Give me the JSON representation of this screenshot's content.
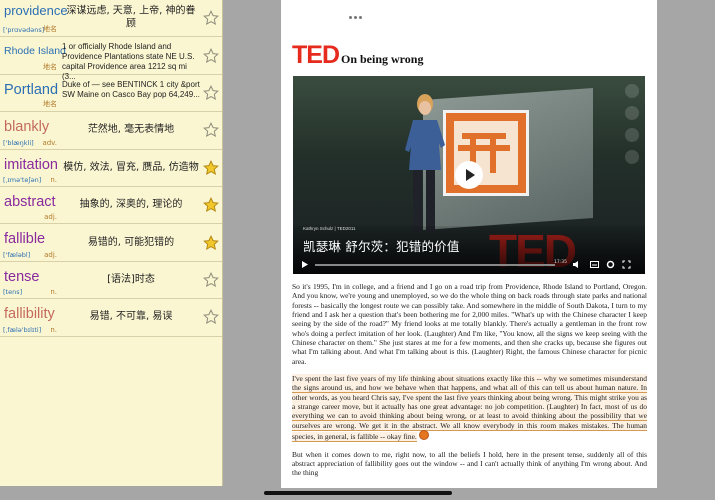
{
  "vocab": [
    {
      "word": "providence",
      "color": "#2a6fb3",
      "size": "normal",
      "phonetic": "['prɑvədəns]",
      "pos": "地名",
      "definition": "深谋远虑, 天意, 上帝, 神的眷顾",
      "multi": false,
      "starred": false
    },
    {
      "word": "Rhode Island",
      "color": "#2a6fb3",
      "size": "small",
      "phonetic": "",
      "pos": "地名",
      "definition": "1 or officially Rhode Island and Providence Plantations state NE U.S. capital Providence area 1212 sq mi (3...",
      "multi": true,
      "starred": false
    },
    {
      "word": "Portland",
      "color": "#2a6fb3",
      "size": "big",
      "phonetic": "",
      "pos": "地名",
      "definition": "Duke of — see BENTINCK 1 city &port SW Maine on Casco Bay pop 64,249...",
      "multi": true,
      "starred": false
    },
    {
      "word": "blankly",
      "color": "#c46a5c",
      "size": "big",
      "phonetic": "['blæŋkli]",
      "pos": "adv.",
      "definition": "茫然地, 毫无表情地",
      "multi": false,
      "starred": false
    },
    {
      "word": "imitation",
      "color": "#8a2a9e",
      "size": "big",
      "phonetic": "[ˌɪmə'teʃən]",
      "pos": "n.",
      "definition": "模仿, 效法, 冒充, 赝品, 仿造物",
      "multi": false,
      "starred": true
    },
    {
      "word": "abstract",
      "color": "#8a2a9e",
      "size": "big",
      "phonetic": "",
      "pos": "adj.",
      "definition": "抽象的, 深奥的, 理论的",
      "multi": false,
      "starred": true
    },
    {
      "word": "fallible",
      "color": "#8a2a9e",
      "size": "big",
      "phonetic": "['fæləbl]",
      "pos": "adj.",
      "definition": "易错的, 可能犯错的",
      "multi": false,
      "starred": true
    },
    {
      "word": "tense",
      "color": "#8a2a9e",
      "size": "big",
      "phonetic": "[tens]",
      "pos": "n.",
      "definition": "[语法]时态",
      "multi": false,
      "starred": false
    },
    {
      "word": "fallibility",
      "color": "#c46a5c",
      "size": "big",
      "phonetic": "[ˌfælə'bɪlɪti]",
      "pos": "n.",
      "definition": "易错, 不可靠, 易误",
      "multi": false,
      "starred": false
    }
  ],
  "reader": {
    "logo": "TED",
    "title": "On being wrong",
    "video": {
      "credit": "Kathryn Schulz | TED2011",
      "caption": "凯瑟琳 舒尔茨：犯错的价值",
      "time": "17:35"
    },
    "paragraph1": "So it's 1995, I'm in college, and a friend and I go on a road trip from Providence, Rhode Island to Portland, Oregon. And you know, we're young and unemployed, so we do the whole thing on back roads through state parks and national forests -- basically the longest route we can possibly take. And somewhere in the middle of South Dakota, I turn to my friend and I ask her a question that's been bothering me for 2,000 miles. \"What's up with the Chinese character I keep seeing by the side of the road?\" My friend looks at me totally blankly. There's actually a gentleman in the front row who's doing a perfect imitation of her look. (Laughter) And I'm like, \"You know, all the signs we keep seeing with the Chinese character on them.\" She just stares at me for a few moments, and then she cracks up, because she figures out what I'm talking about. And what I'm talking about is this. (Laughter) Right, the famous Chinese character for picnic area.",
    "paragraph2": "I've spent the last five years of my life thinking about situations exactly like this -- why we sometimes misunderstand the signs around us, and how we behave when that happens, and what all of this can tell us about human nature. In other words, as you heard Chris say, I've spent the last five years thinking about being wrong. This might strike you as a strange career move, but it actually has one great advantage: no job competition. (Laughter) In fact, most of us do everything we can to avoid thinking about being wrong, or at least to avoid thinking about the possibility that we ourselves are wrong. We get it in the abstract. We all know everybody in this room makes mistakes. The human species, in general, is fallible -- okay fine.",
    "paragraph3": "But when it comes down to me, right now, to all the beliefs I hold, here in the present tense, suddenly all of this abstract appreciation of fallibility goes out the window -- and I can't actually think of anything I'm wrong about. And the thing"
  },
  "colors": {
    "ted_red": "#e62b1e",
    "highlight_underline": "#d49a55",
    "list_background": "#fbf6d2",
    "star_gold": "#f2c72c"
  }
}
